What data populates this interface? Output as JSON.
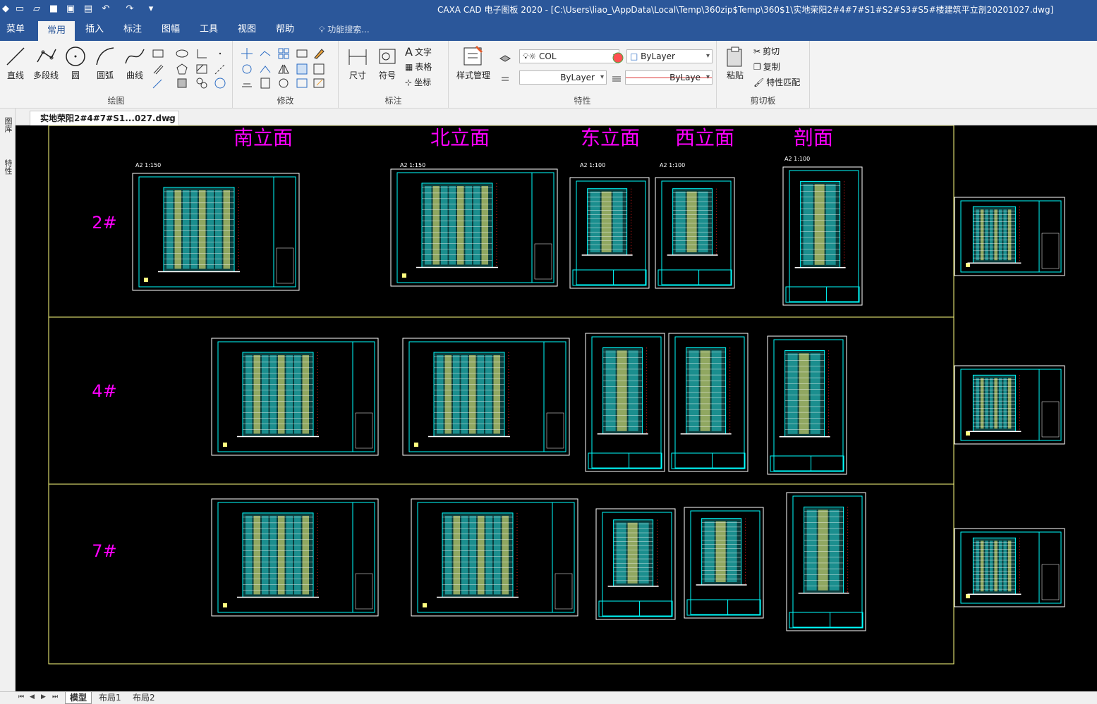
{
  "app_title": "CAXA CAD 电子图板 2020 - [C:\\Users\\liao_\\AppData\\Local\\Temp\\360zip$Temp\\360$1\\实地荣阳2#4#7#S1#S2#S3#S5#楼建筑平立剖20201027.dwg]",
  "menu": {
    "items": [
      "菜单",
      "常用",
      "插入",
      "标注",
      "图幅",
      "工具",
      "视图",
      "帮助"
    ],
    "search_label": "功能搜索..."
  },
  "ribbon": {
    "draw": {
      "label": "绘图",
      "line": "直线",
      "polyline": "多段线",
      "circle": "圆",
      "arc": "圆弧",
      "curve": "曲线"
    },
    "modify": {
      "label": "修改"
    },
    "annotate": {
      "label": "标注",
      "dimension": "尺寸",
      "symbol": "符号",
      "text": "文字",
      "table": "表格",
      "coordinate": "坐标"
    },
    "properties": {
      "label": "特性",
      "style_mgr": "样式管理",
      "layer_value": "COL",
      "color_value": "ByLayer",
      "linetype_value": "ByLayer",
      "lineweight_value": "ByLaye"
    },
    "clipboard": {
      "label": "剪切板",
      "paste": "粘贴",
      "cut": "剪切",
      "copy": "复制",
      "match": "特性匹配"
    }
  },
  "doc_tab": {
    "name": "实地荣阳2#4#7#S1...027.dwg",
    "close": "×"
  },
  "left_panels": [
    "图库",
    "特性"
  ],
  "drawing": {
    "column_titles": [
      "南立面",
      "北立面",
      "东立面",
      "西立面",
      "剖面"
    ],
    "row_labels": [
      "2#",
      "4#",
      "7#"
    ],
    "scale_notes": [
      "A2 1:150",
      "A2 1:150",
      "A2 1:100",
      "A2 1:100",
      "A2 1:100"
    ]
  },
  "layout_tabs": [
    "模型",
    "布局1",
    "布局2"
  ],
  "colors": {
    "title_bar": "#2b579a",
    "ribbon": "#f3f3f3",
    "canvas": "#000000",
    "magenta": "#ff00ff",
    "cyan": "#00ffff",
    "yellow": "#ffff80",
    "red": "#ff2020"
  }
}
